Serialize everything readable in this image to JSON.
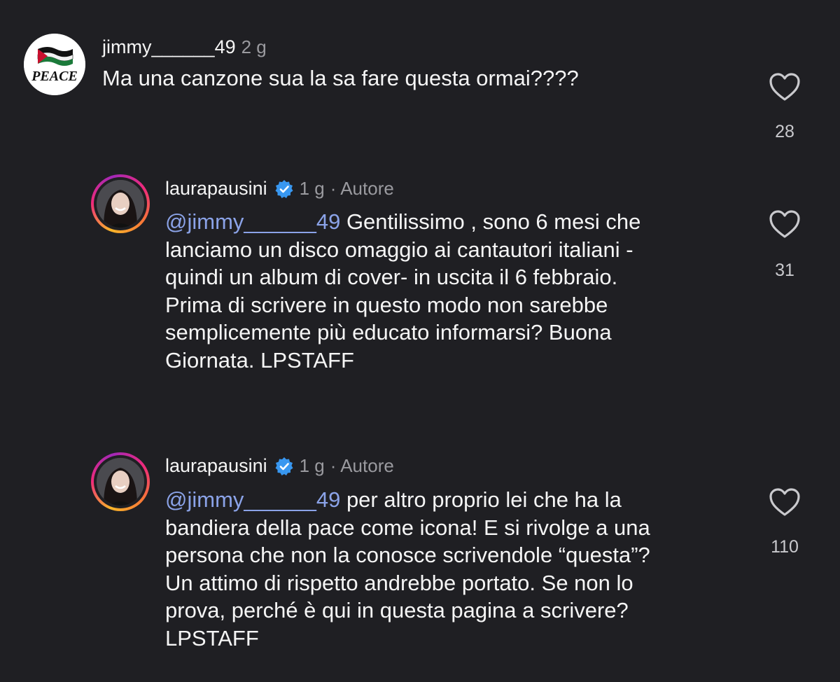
{
  "comments": [
    {
      "username": "jimmy______49",
      "time": "2 g",
      "author_tag": "",
      "text": "Ma una canzone sua la sa fare questa ormai????",
      "mention": "",
      "likes": "28",
      "avatar_icon": "peace-flag-icon",
      "avatar_text": "PEACE"
    },
    {
      "username": "laurapausini",
      "time": "1 g",
      "author_tag": "· Autore",
      "mention": "@jimmy______49",
      "text_lines": [
        " Gentilissimo , sono 6 mesi che",
        "lanciamo un disco omaggio ai cantautori italiani -",
        "quindi un album di cover- in uscita il 6 febbraio.",
        "Prima di scrivere in questo modo non sarebbe",
        "semplicemente più educato informarsi? Buona",
        "Giornata. LPSTAFF"
      ],
      "likes": "31",
      "verified": true
    },
    {
      "username": "laurapausini",
      "time": "1 g",
      "author_tag": "· Autore",
      "mention": "@jimmy______49",
      "text_lines": [
        " per altro proprio lei che ha la",
        "bandiera della pace come icona! E si rivolge a una",
        "persona che non la conosce scrivendole “questa”?",
        "Un attimo di rispetto andrebbe portato. Se non lo",
        "prova, perché è qui in questa pagina a scrivere?",
        "LPSTAFF"
      ],
      "likes": "110",
      "verified": true
    }
  ],
  "colors": {
    "background": "#1f1f23",
    "mention": "#8ba3e8",
    "verified": "#3897f0",
    "muted": "#9a9a9f"
  }
}
